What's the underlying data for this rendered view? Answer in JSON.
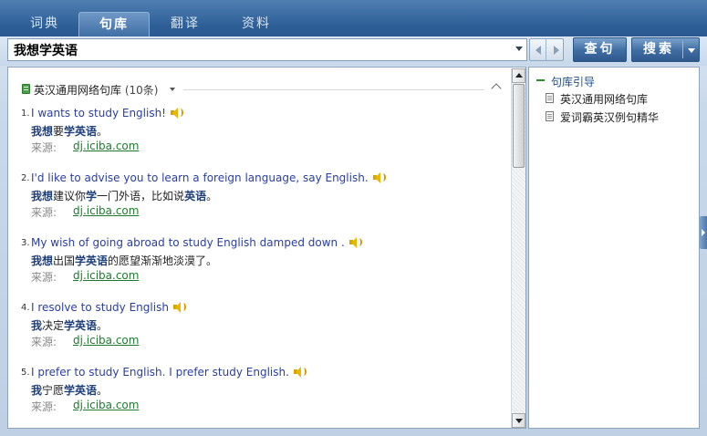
{
  "tabs": [
    {
      "label": "词典",
      "active": false
    },
    {
      "label": "句库",
      "active": true
    },
    {
      "label": "翻译",
      "active": false
    },
    {
      "label": "资料",
      "active": false
    }
  ],
  "search": {
    "value": "我想学英语",
    "query_button": "查句",
    "search_button": "搜索"
  },
  "section": {
    "title": "英汉通用网络句库",
    "count": "(10条)"
  },
  "entries": [
    {
      "num": "1.",
      "en": "I wants to study English!",
      "zh_parts": [
        [
          "我想",
          true
        ],
        [
          "要",
          false
        ],
        [
          "学英语",
          true
        ],
        [
          "。",
          false
        ]
      ],
      "source_label": "来源:",
      "source": "dj.iciba.com"
    },
    {
      "num": "2.",
      "en": "I'd like to advise you to learn a foreign language, say English.",
      "zh_parts": [
        [
          "我想",
          true
        ],
        [
          "建议你",
          false
        ],
        [
          "学",
          true
        ],
        [
          "一门外语，比如说",
          false
        ],
        [
          "英语",
          true
        ],
        [
          "。",
          false
        ]
      ],
      "source_label": "来源:",
      "source": "dj.iciba.com"
    },
    {
      "num": "3.",
      "en": "My wish of going abroad to study English damped down .",
      "zh_parts": [
        [
          "我想",
          true
        ],
        [
          "出国",
          false
        ],
        [
          "学英语",
          true
        ],
        [
          "的愿望渐渐地淡漠了。",
          false
        ]
      ],
      "source_label": "来源:",
      "source": "dj.iciba.com"
    },
    {
      "num": "4.",
      "en": "I resolve to study English",
      "zh_parts": [
        [
          "我",
          true
        ],
        [
          "决定",
          false
        ],
        [
          "学英语",
          true
        ],
        [
          "。",
          false
        ]
      ],
      "source_label": "来源:",
      "source": "dj.iciba.com"
    },
    {
      "num": "5.",
      "en": "I prefer to study English. I prefer study English.",
      "zh_parts": [
        [
          "我",
          true
        ],
        [
          "宁愿",
          false
        ],
        [
          "学英语",
          true
        ],
        [
          "。",
          false
        ]
      ],
      "source_label": "来源:",
      "source": "dj.iciba.com"
    }
  ],
  "sidebar": {
    "title": "句库引导",
    "items": [
      {
        "label": "英汉通用网络句库"
      },
      {
        "label": "爱词霸英汉例句精华"
      }
    ]
  },
  "icons": {
    "section": "database-icon",
    "speaker": "speaker-icon",
    "doc": "document-icon"
  }
}
